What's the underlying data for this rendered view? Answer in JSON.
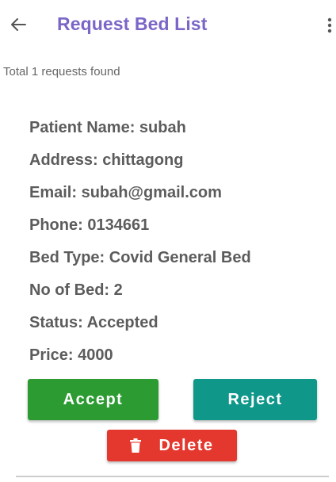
{
  "appbar": {
    "title": "Request Bed List",
    "back_icon": "arrow-left-icon",
    "menu_icon": "more-vert-icon"
  },
  "summary": "Total 1 requests found",
  "request": {
    "patient_name": "Patient Name: subah",
    "address": "Address: chittagong",
    "email": "Email: subah@gmail.com",
    "phone": "Phone: 0134661",
    "bed_type": "Bed Type: Covid General Bed",
    "no_of_bed": "No of Bed: 2",
    "status": "Status: Accepted",
    "price": "Price: 4000"
  },
  "actions": {
    "accept_label": "Accept",
    "reject_label": "Reject",
    "delete_label": "Delete",
    "delete_icon": "trash-icon"
  },
  "colors": {
    "title": "#7b66c8",
    "accept": "#2c9b32",
    "reject": "#0f978a",
    "delete": "#e4372d"
  }
}
